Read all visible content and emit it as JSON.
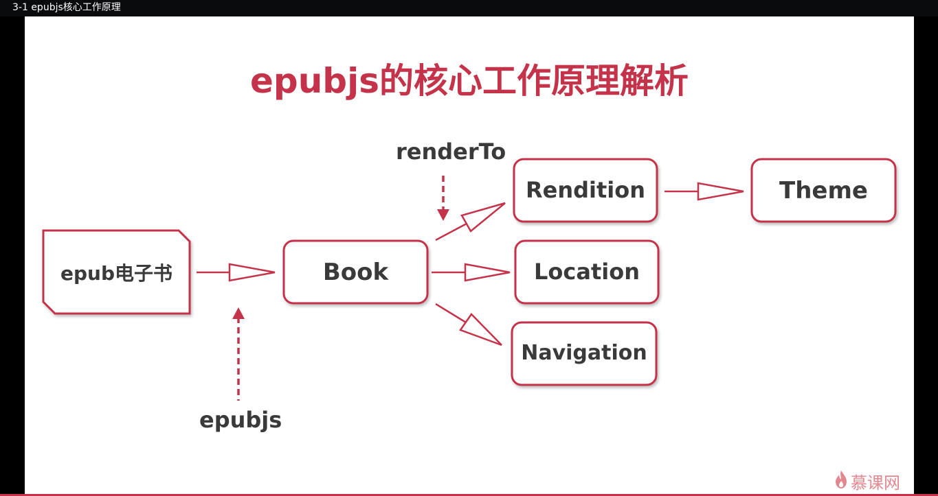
{
  "window": {
    "title": "3-1 epubjs核心工作原理"
  },
  "slide": {
    "title": "epubjs的核心工作原理解析",
    "accent_color": "#c4334a",
    "text_color": "#3a3a3a",
    "nodes": {
      "epub": "epub电子书",
      "book": "Book",
      "rendition": "Rendition",
      "theme": "Theme",
      "location": "Location",
      "navigation": "Navigation"
    },
    "labels": {
      "render_to": "renderTo",
      "epubjs": "epubjs"
    },
    "watermark": {
      "text": "慕课网",
      "icon": "flame-icon"
    }
  }
}
